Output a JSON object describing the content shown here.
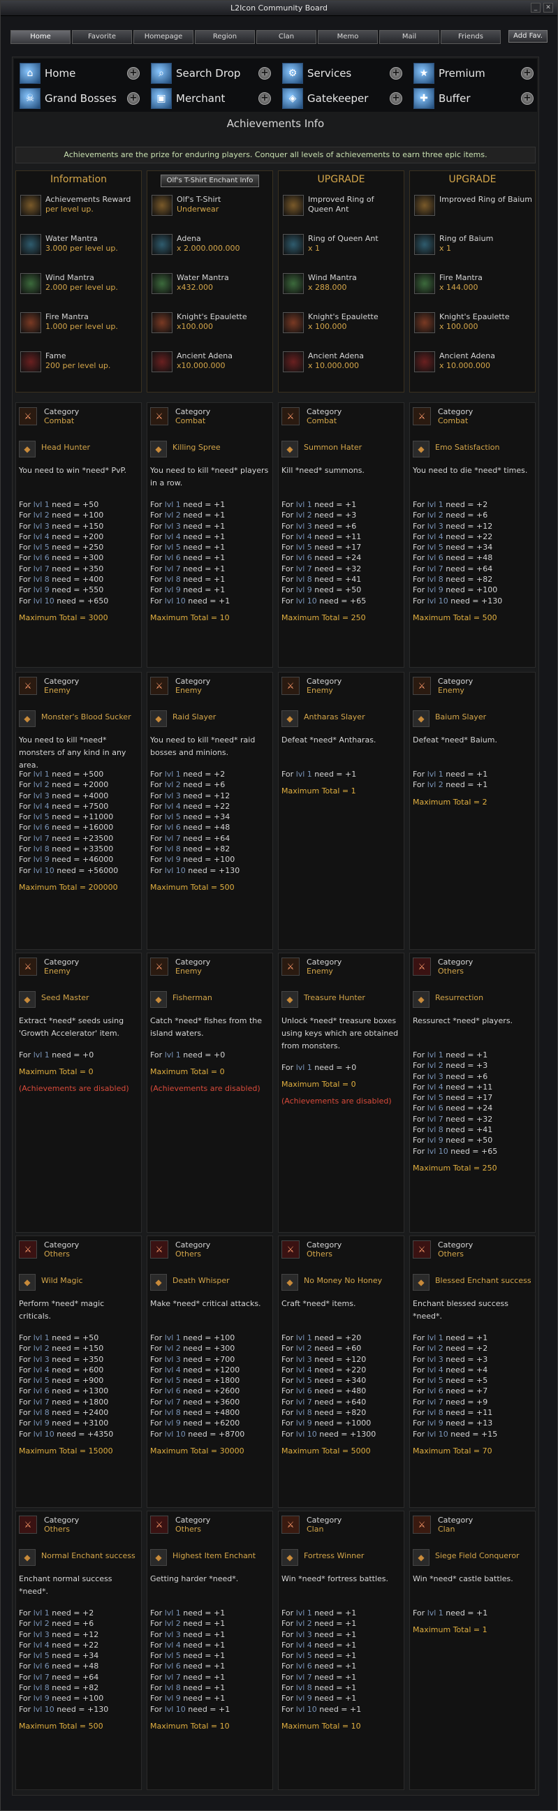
{
  "window": {
    "title": "L2Icon Community Board"
  },
  "tabs": [
    "Home",
    "Favorite",
    "Homepage",
    "Region",
    "Clan",
    "Memo",
    "Mail",
    "Friends"
  ],
  "add_fav": "Add Fav.",
  "nav": [
    {
      "label": "Home",
      "icon": "home-icon"
    },
    {
      "label": "Search Drop",
      "icon": "search-drop-icon"
    },
    {
      "label": "Services",
      "icon": "services-icon"
    },
    {
      "label": "Premium",
      "icon": "premium-icon"
    },
    {
      "label": "Grand Bosses",
      "icon": "grand-bosses-icon"
    },
    {
      "label": "Merchant",
      "icon": "merchant-icon"
    },
    {
      "label": "Gatekeeper",
      "icon": "gatekeeper-icon"
    },
    {
      "label": "Buffer",
      "icon": "buffer-icon"
    }
  ],
  "achievements_title": "Achievements Info",
  "banner": "Achievements are the prize for enduring players. Conquer all levels of achievements to earn three epic items.",
  "panels": [
    {
      "title": "Information",
      "items": [
        {
          "name": "Achievements Reward",
          "sub": "per level up."
        },
        {
          "name": "Water Mantra",
          "sub": "3.000 per level up."
        },
        {
          "name": "Wind Mantra",
          "sub": "2.000 per level up."
        },
        {
          "name": "Fire Mantra",
          "sub": "1.000 per level up."
        },
        {
          "name": "Fame",
          "sub": "200 per level up."
        }
      ]
    },
    {
      "title": "Olf's T-Shirt Enchant Info",
      "items": [
        {
          "name": "Olf's T-Shirt",
          "sub": "Underwear"
        },
        {
          "name": "Adena",
          "sub": "x 2.000.000.000"
        },
        {
          "name": "Water Mantra",
          "sub": "x432.000"
        },
        {
          "name": "Knight's Epaulette",
          "sub": "x100.000"
        },
        {
          "name": "Ancient Adena",
          "sub": "x10.000.000"
        }
      ]
    },
    {
      "title": "UPGRADE",
      "items": [
        {
          "name": "Improved Ring of Queen Ant",
          "sub": ""
        },
        {
          "name": "Ring of Queen Ant",
          "sub": "x 1"
        },
        {
          "name": "Wind Mantra",
          "sub": "x 288.000"
        },
        {
          "name": "Knight's Epaulette",
          "sub": "x 100.000"
        },
        {
          "name": "Ancient Adena",
          "sub": "x 10.000.000"
        }
      ]
    },
    {
      "title": "UPGRADE",
      "items": [
        {
          "name": "Improved Ring of Baium",
          "sub": ""
        },
        {
          "name": "Ring of Baium",
          "sub": "x 1"
        },
        {
          "name": "Fire Mantra",
          "sub": "x 144.000"
        },
        {
          "name": "Knight's Epaulette",
          "sub": "x 100.000"
        },
        {
          "name": "Ancient Adena",
          "sub": "x 10.000.000"
        }
      ]
    }
  ],
  "category_label": "Category",
  "cards": [
    {
      "category": "Combat",
      "name": "Head Hunter",
      "desc": "You need to win *need* PvP.",
      "levels": [
        50,
        100,
        150,
        200,
        250,
        300,
        350,
        400,
        550,
        650
      ],
      "max": "Maximum Total = 3000"
    },
    {
      "category": "Combat",
      "name": "Killing Spree",
      "desc": "You need to kill *need* players in a row.",
      "levels": [
        1,
        1,
        1,
        1,
        1,
        1,
        1,
        1,
        1,
        1
      ],
      "max": "Maximum Total = 10"
    },
    {
      "category": "Combat",
      "name": "Summon Hater",
      "desc": "Kill *need* summons.",
      "levels": [
        1,
        3,
        6,
        11,
        17,
        24,
        32,
        41,
        50,
        65
      ],
      "max": "Maximum Total = 250"
    },
    {
      "category": "Combat",
      "name": "Emo Satisfaction",
      "desc": "You need to die *need* times.",
      "levels": [
        2,
        6,
        12,
        22,
        34,
        48,
        64,
        82,
        100,
        130
      ],
      "max": "Maximum Total = 500"
    },
    {
      "category": "Enemy",
      "name": "Monster's Blood Sucker",
      "desc": "You need to kill *need* monsters of any kind in any area.",
      "levels": [
        500,
        2000,
        4000,
        7500,
        11000,
        16000,
        23500,
        33500,
        46000,
        56000
      ],
      "max": "Maximum Total = 200000"
    },
    {
      "category": "Enemy",
      "name": "Raid Slayer",
      "desc": "You need to kill *need* raid bosses and minions.",
      "levels": [
        2,
        6,
        12,
        22,
        34,
        48,
        64,
        82,
        100,
        130
      ],
      "max": "Maximum Total = 500"
    },
    {
      "category": "Enemy",
      "name": "Antharas Slayer",
      "desc": "Defeat *need* Antharas.",
      "levels": [
        1
      ],
      "max": "Maximum Total = 1"
    },
    {
      "category": "Enemy",
      "name": "Baium Slayer",
      "desc": "Defeat *need* Baium.",
      "levels": [
        1,
        1
      ],
      "max": "Maximum Total = 2"
    },
    {
      "category": "Enemy",
      "name": "Seed Master",
      "desc": "Extract *need* seeds using 'Growth Accelerator' item.",
      "levels": [
        0
      ],
      "max": "Maximum Total = 0",
      "disabled": "(Achievements are disabled)"
    },
    {
      "category": "Enemy",
      "name": "Fisherman",
      "desc": "Catch *need* fishes from the island waters.",
      "levels": [
        0
      ],
      "max": "Maximum Total = 0",
      "disabled": "(Achievements are disabled)"
    },
    {
      "category": "Enemy",
      "name": "Treasure Hunter",
      "desc": "Unlock *need* treasure boxes using keys which are obtained from monsters.",
      "levels": [
        0
      ],
      "max": "Maximum Total = 0",
      "disabled": "(Achievements are disabled)"
    },
    {
      "category": "Others",
      "name": "Resurrection",
      "desc": "Ressurect *need* players.",
      "levels": [
        1,
        3,
        6,
        11,
        17,
        24,
        32,
        41,
        50,
        65
      ],
      "max": "Maximum Total = 250"
    },
    {
      "category": "Others",
      "name": "Wild Magic",
      "desc": "Perform *need* magic criticals.",
      "levels": [
        50,
        150,
        350,
        600,
        900,
        1300,
        1800,
        2400,
        3100,
        4350
      ],
      "max": "Maximum Total = 15000"
    },
    {
      "category": "Others",
      "name": "Death Whisper",
      "desc": "Make *need* critical attacks.",
      "levels": [
        100,
        300,
        700,
        1200,
        1800,
        2600,
        3600,
        4800,
        6200,
        8700
      ],
      "max": "Maximum Total = 30000"
    },
    {
      "category": "Others",
      "name": "No Money No Honey",
      "desc": "Craft *need* items.",
      "levels": [
        20,
        60,
        120,
        220,
        340,
        480,
        640,
        820,
        1000,
        1300
      ],
      "max": "Maximum Total = 5000"
    },
    {
      "category": "Others",
      "name": "Blessed Enchant success",
      "desc": "Enchant blessed success *need*.",
      "levels": [
        1,
        2,
        3,
        4,
        5,
        7,
        9,
        11,
        13,
        15
      ],
      "max": "Maximum Total = 70"
    },
    {
      "category": "Others",
      "name": "Normal Enchant success",
      "desc": "Enchant normal success *need*.",
      "levels": [
        2,
        6,
        12,
        22,
        34,
        48,
        64,
        82,
        100,
        130
      ],
      "max": "Maximum Total = 500"
    },
    {
      "category": "Others",
      "name": "Highest Item Enchant",
      "desc": "Getting harder *need*.",
      "levels": [
        1,
        1,
        1,
        1,
        1,
        1,
        1,
        1,
        1,
        1
      ],
      "max": "Maximum Total = 10"
    },
    {
      "category": "Clan",
      "name": "Fortress Winner",
      "desc": "Win *need* fortress battles.",
      "levels": [
        1,
        1,
        1,
        1,
        1,
        1,
        1,
        1,
        1,
        1
      ],
      "max": "Maximum Total = 10"
    },
    {
      "category": "Clan",
      "name": "Siege Field Conqueror",
      "desc": "Win *need* castle battles.",
      "levels": [
        1
      ],
      "max": "Maximum Total = 1"
    }
  ],
  "level_prefix": "For",
  "level_word": "lvl",
  "need_word": "need ="
}
